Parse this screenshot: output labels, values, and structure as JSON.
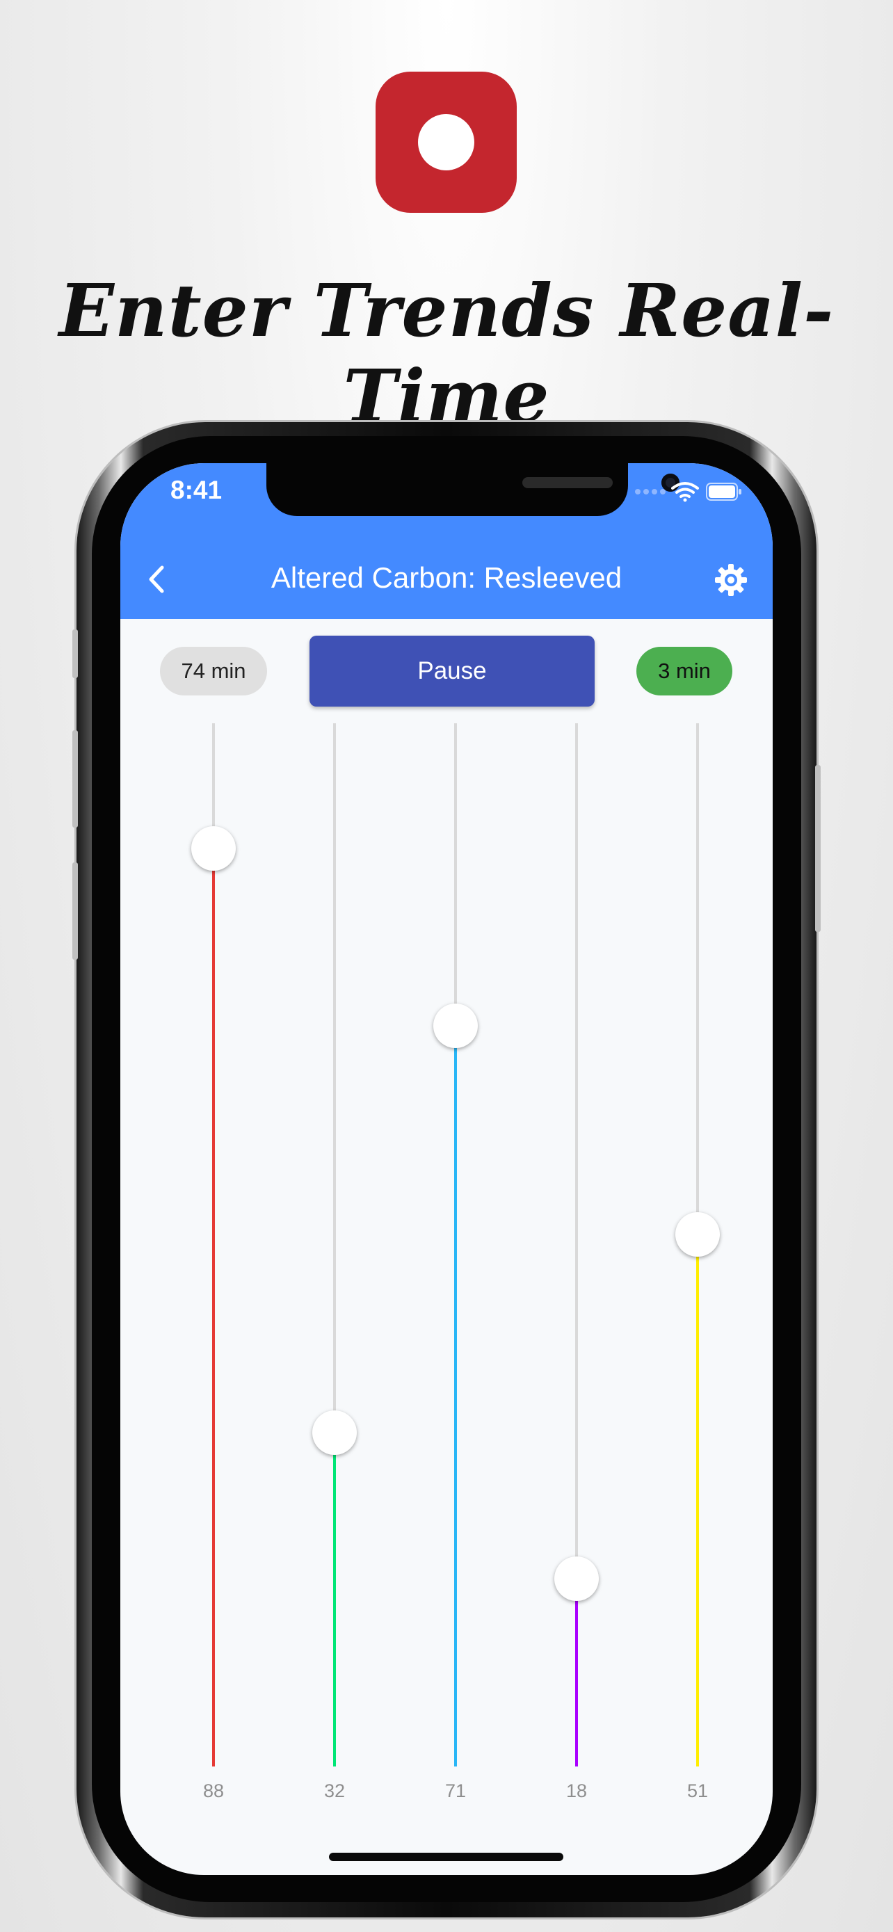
{
  "promo": {
    "headline": "Enter Trends Real-Time",
    "logo_color": "#c4262e"
  },
  "status_bar": {
    "time": "8:41",
    "icons": [
      "signal-icon",
      "wifi-icon",
      "battery-icon"
    ]
  },
  "app_bar": {
    "title": "Altered Carbon: Resleeved",
    "back_icon": "chevron-left-icon",
    "settings_icon": "gear-icon",
    "color": "#448aff"
  },
  "controls": {
    "elapsed": "74 min",
    "pause_label": "Pause",
    "remaining": "3 min",
    "pause_color": "#3f51b5",
    "remaining_color": "#4caf50"
  },
  "sliders": [
    {
      "label": "88",
      "value": 88,
      "color": "#e53935"
    },
    {
      "label": "32",
      "value": 32,
      "color": "#00e676"
    },
    {
      "label": "71",
      "value": 71,
      "color": "#29b6f6"
    },
    {
      "label": "18",
      "value": 18,
      "color": "#aa00ff"
    },
    {
      "label": "51",
      "value": 51,
      "color": "#ffee00"
    }
  ]
}
